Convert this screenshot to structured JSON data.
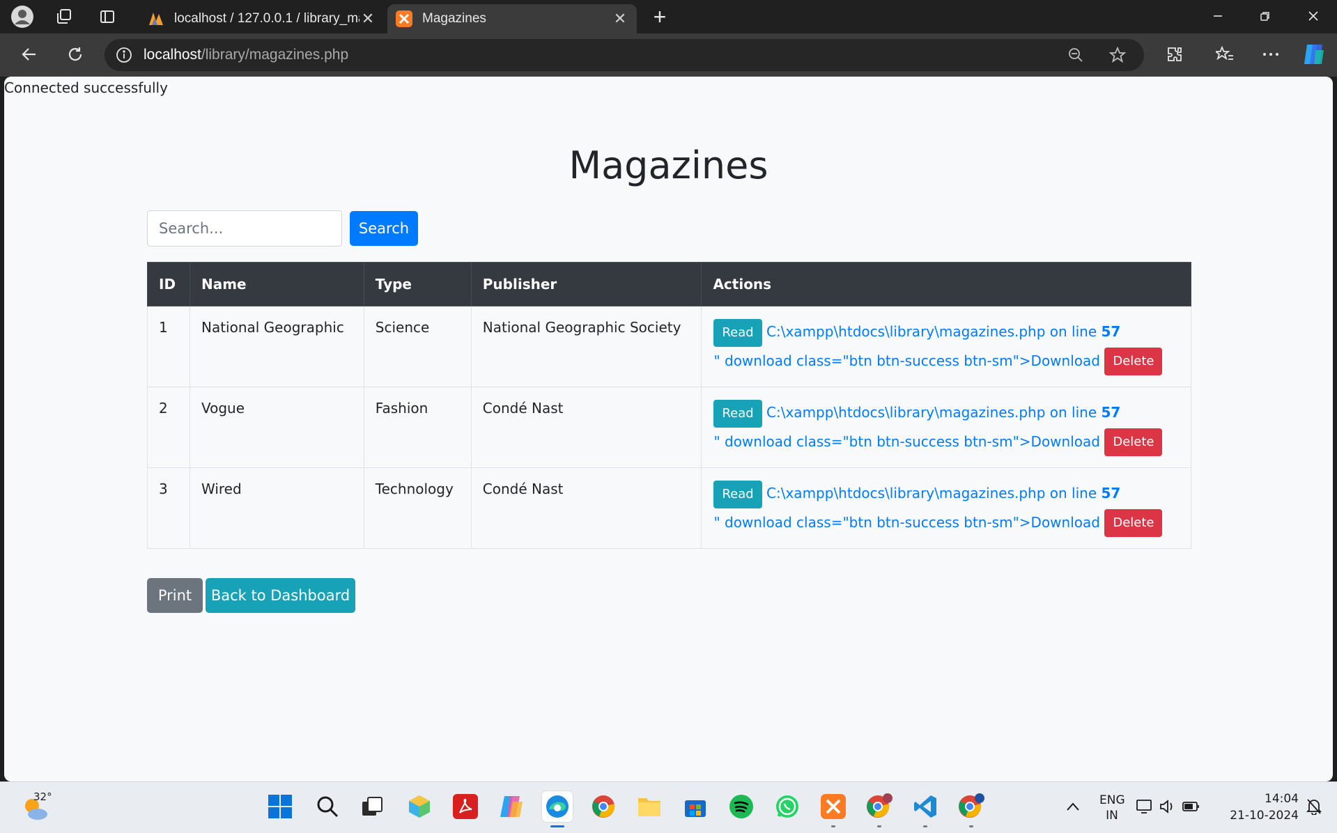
{
  "browser": {
    "tabs": [
      {
        "title": "localhost / 127.0.0.1 / library_man",
        "active": false
      },
      {
        "title": "Magazines",
        "active": true
      }
    ],
    "url_host": "localhost",
    "url_path": "/library/magazines.php"
  },
  "page": {
    "status": "Connected successfully",
    "title": "Magazines",
    "search_placeholder": "Search...",
    "search_button": "Search",
    "columns": [
      "ID",
      "Name",
      "Type",
      "Publisher",
      "Actions"
    ],
    "rows": [
      {
        "id": "1",
        "name": "National Geographic",
        "type": "Science",
        "publisher": "National Geographic Society"
      },
      {
        "id": "2",
        "name": "Vogue",
        "type": "Fashion",
        "publisher": "Condé Nast"
      },
      {
        "id": "3",
        "name": "Wired",
        "type": "Technology",
        "publisher": "Condé Nast"
      }
    ],
    "actions": {
      "read": "Read",
      "error_link": "C:\\xampp\\htdocs\\library\\magazines.php on line ",
      "error_line": "57",
      "download_text": "\" download class=\"btn btn-success btn-sm\">Download",
      "delete": "Delete"
    },
    "print_button": "Print",
    "back_button": "Back to Dashboard"
  },
  "taskbar": {
    "temperature": "32°",
    "language": "ENG",
    "region": "IN",
    "time": "14:04",
    "date": "21-10-2024"
  },
  "colors": {
    "primary": "#007bff",
    "info": "#17a2b8",
    "danger": "#dc3545",
    "secondary": "#6c757d",
    "table_header": "#343a40"
  }
}
